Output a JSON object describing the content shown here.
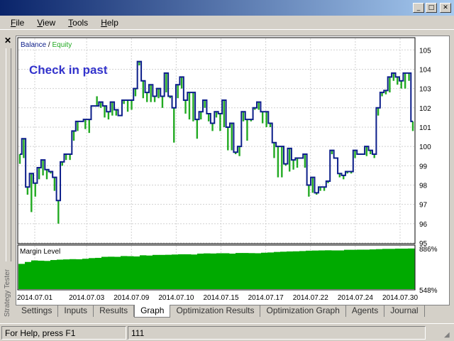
{
  "window": {
    "minimize": "_",
    "maximize": "□",
    "close": "✕"
  },
  "menu": [
    {
      "pre": "",
      "key": "F",
      "post": "ile"
    },
    {
      "pre": "",
      "key": "V",
      "post": "iew"
    },
    {
      "pre": "",
      "key": "T",
      "post": "ools"
    },
    {
      "pre": "",
      "key": "H",
      "post": "elp"
    }
  ],
  "panel": {
    "close": "✕",
    "side_label": "Strategy Tester"
  },
  "chart": {
    "legend_balance": "Balance",
    "legend_sep": " / ",
    "legend_equity": "Equity",
    "annotation": "Check in past",
    "margin_label": "Margin Level",
    "margin_top_label": "886%",
    "margin_bottom_label": "548%",
    "colors": {
      "balance": "#0c1e8a",
      "equity": "#22aa22",
      "margin": "#00aa00",
      "annotation": "#3333cc",
      "grid": "#d0d0d0"
    }
  },
  "chart_data": [
    {
      "type": "line",
      "title": "",
      "series": [
        {
          "name": "Balance",
          "values": [
            99.6,
            100.4,
            97.9,
            98.6,
            98.1,
            98.9,
            99.3,
            98.8,
            98.7,
            98.4,
            97.2,
            99.2,
            99.6,
            99.6,
            100.8,
            101.3,
            101.3,
            101.4,
            101.4,
            102.1,
            102.1,
            102.3,
            102.1,
            101.8,
            102.3,
            101.9,
            101.6,
            102.4,
            102.4,
            102.4,
            103.0,
            104.4,
            103.4,
            102.8,
            103.2,
            102.6,
            103.0,
            102.6,
            103.8,
            102.6,
            102.0,
            103.2,
            103.6,
            102.4,
            102.8,
            102.8,
            101.4,
            101.8,
            102.4,
            101.7,
            101.2,
            101.8,
            101.7,
            102.4,
            101.0,
            101.2,
            99.7,
            100.0,
            101.8,
            101.4,
            101.4,
            102.0,
            102.3,
            101.8,
            101.8,
            101.2,
            100.2,
            100.0,
            100.0,
            99.1,
            99.9,
            99.3,
            99.4,
            99.4,
            99.6,
            98.0,
            98.4,
            97.6,
            97.9,
            97.9,
            98.2,
            99.8,
            99.4,
            98.6,
            98.5,
            98.7,
            98.7,
            99.8,
            99.6,
            99.6,
            100.0,
            99.8,
            99.6,
            102.0,
            102.8,
            102.9,
            103.6,
            103.8,
            103.6,
            103.4,
            103.8,
            103.8,
            101.3
          ]
        },
        {
          "name": "Equity",
          "values": [
            99.1,
            99.4,
            97.5,
            96.6,
            97.4,
            98.3,
            98.5,
            98.3,
            98.6,
            97.7,
            96.0,
            99.0,
            99.3,
            99.3,
            100.3,
            100.8,
            101.3,
            100.9,
            100.7,
            102.1,
            102.6,
            102.0,
            101.5,
            101.4,
            101.6,
            101.6,
            101.6,
            102.2,
            101.8,
            101.9,
            102.6,
            104.2,
            102.5,
            102.3,
            102.3,
            102.3,
            102.5,
            102.0,
            102.8,
            102.5,
            100.2,
            102.5,
            103.0,
            101.7,
            101.4,
            101.3,
            100.4,
            101.4,
            102.0,
            101.3,
            100.8,
            101.5,
            100.8,
            101.0,
            99.8,
            99.8,
            99.6,
            99.5,
            101.3,
            100.3,
            101.3,
            101.9,
            101.9,
            101.2,
            101.0,
            101.0,
            99.4,
            98.4,
            98.4,
            99.0,
            98.7,
            98.8,
            98.9,
            99.4,
            98.9,
            97.4,
            97.6,
            97.5,
            97.7,
            97.7,
            98.1,
            99.6,
            99.4,
            98.4,
            98.3,
            98.6,
            98.6,
            99.4,
            99.6,
            99.6,
            99.5,
            99.6,
            99.4,
            101.6,
            102.6,
            102.7,
            102.8,
            103.4,
            103.2,
            103.0,
            103.0,
            103.4,
            100.8
          ]
        }
      ],
      "x_ticks": [
        "2014.07.01",
        "2014.07.03",
        "2014.07.09",
        "2014.07.10",
        "2014.07.15",
        "2014.07.17",
        "2014.07.22",
        "2014.07.24",
        "2014.07.30"
      ],
      "y_ticks": [
        95,
        96,
        97,
        98,
        99,
        100,
        101,
        102,
        103,
        104,
        105
      ],
      "ylim": [
        95,
        105.6
      ]
    },
    {
      "type": "area",
      "title": "Margin Level",
      "series": [
        {
          "name": "Margin Level",
          "values": [
            745,
            760,
            772,
            770,
            768,
            775,
            778,
            780,
            782,
            781,
            785,
            790,
            792,
            800,
            801,
            800,
            806,
            805,
            803,
            812,
            810,
            815,
            815,
            816,
            818,
            820,
            820,
            818,
            825,
            827,
            826,
            828,
            828,
            825,
            830,
            830,
            829,
            828,
            832,
            834,
            838,
            840,
            842,
            843,
            845,
            848,
            849,
            850,
            851,
            850,
            850,
            855,
            855,
            856,
            856,
            858,
            860,
            862,
            862,
            864,
            864,
            865
          ]
        }
      ],
      "y_ticks": [
        "548%",
        "886%"
      ],
      "ylim": [
        548,
        886
      ]
    }
  ],
  "tabs": [
    "Settings",
    "Inputs",
    "Results",
    "Graph",
    "Optimization Results",
    "Optimization Graph",
    "Agents",
    "Journal"
  ],
  "active_tab": "Graph",
  "status": {
    "help": "For Help, press F1",
    "value": "111"
  }
}
